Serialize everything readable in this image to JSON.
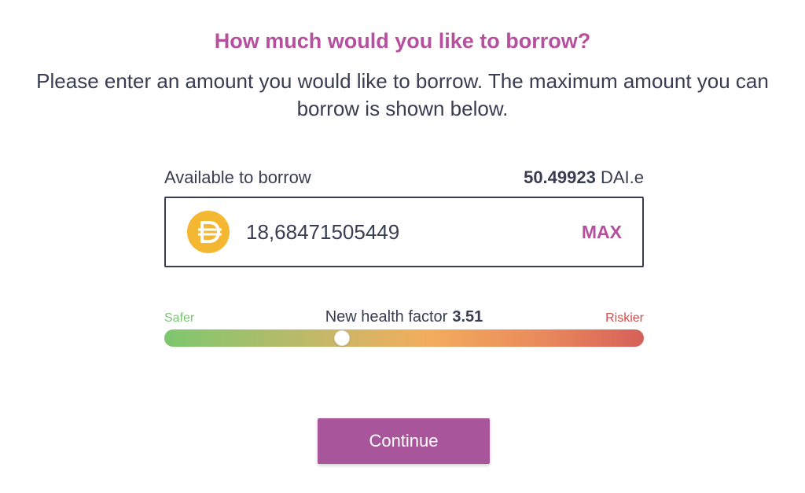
{
  "heading": {
    "title": "How much would you like to borrow?",
    "description": "Please enter an amount you would like to borrow. The maximum amount you can borrow is shown below."
  },
  "available": {
    "label": "Available to borrow",
    "amount": "50.49923",
    "symbol": "DAI.e"
  },
  "amount_input": {
    "value": "18,68471505449",
    "token_icon": "dai-token-icon",
    "max_label": "MAX"
  },
  "health_factor": {
    "safer_label": "Safer",
    "riskier_label": "Riskier",
    "label": "New health factor",
    "value": "3.51",
    "slider_level": 0.37
  },
  "actions": {
    "continue_label": "Continue"
  },
  "colors": {
    "accent": "#b6509e",
    "button": "#a9559b",
    "text": "#383d51",
    "safer": "#7bc475",
    "riskier": "#d64a4a",
    "token": "#f4b731"
  }
}
